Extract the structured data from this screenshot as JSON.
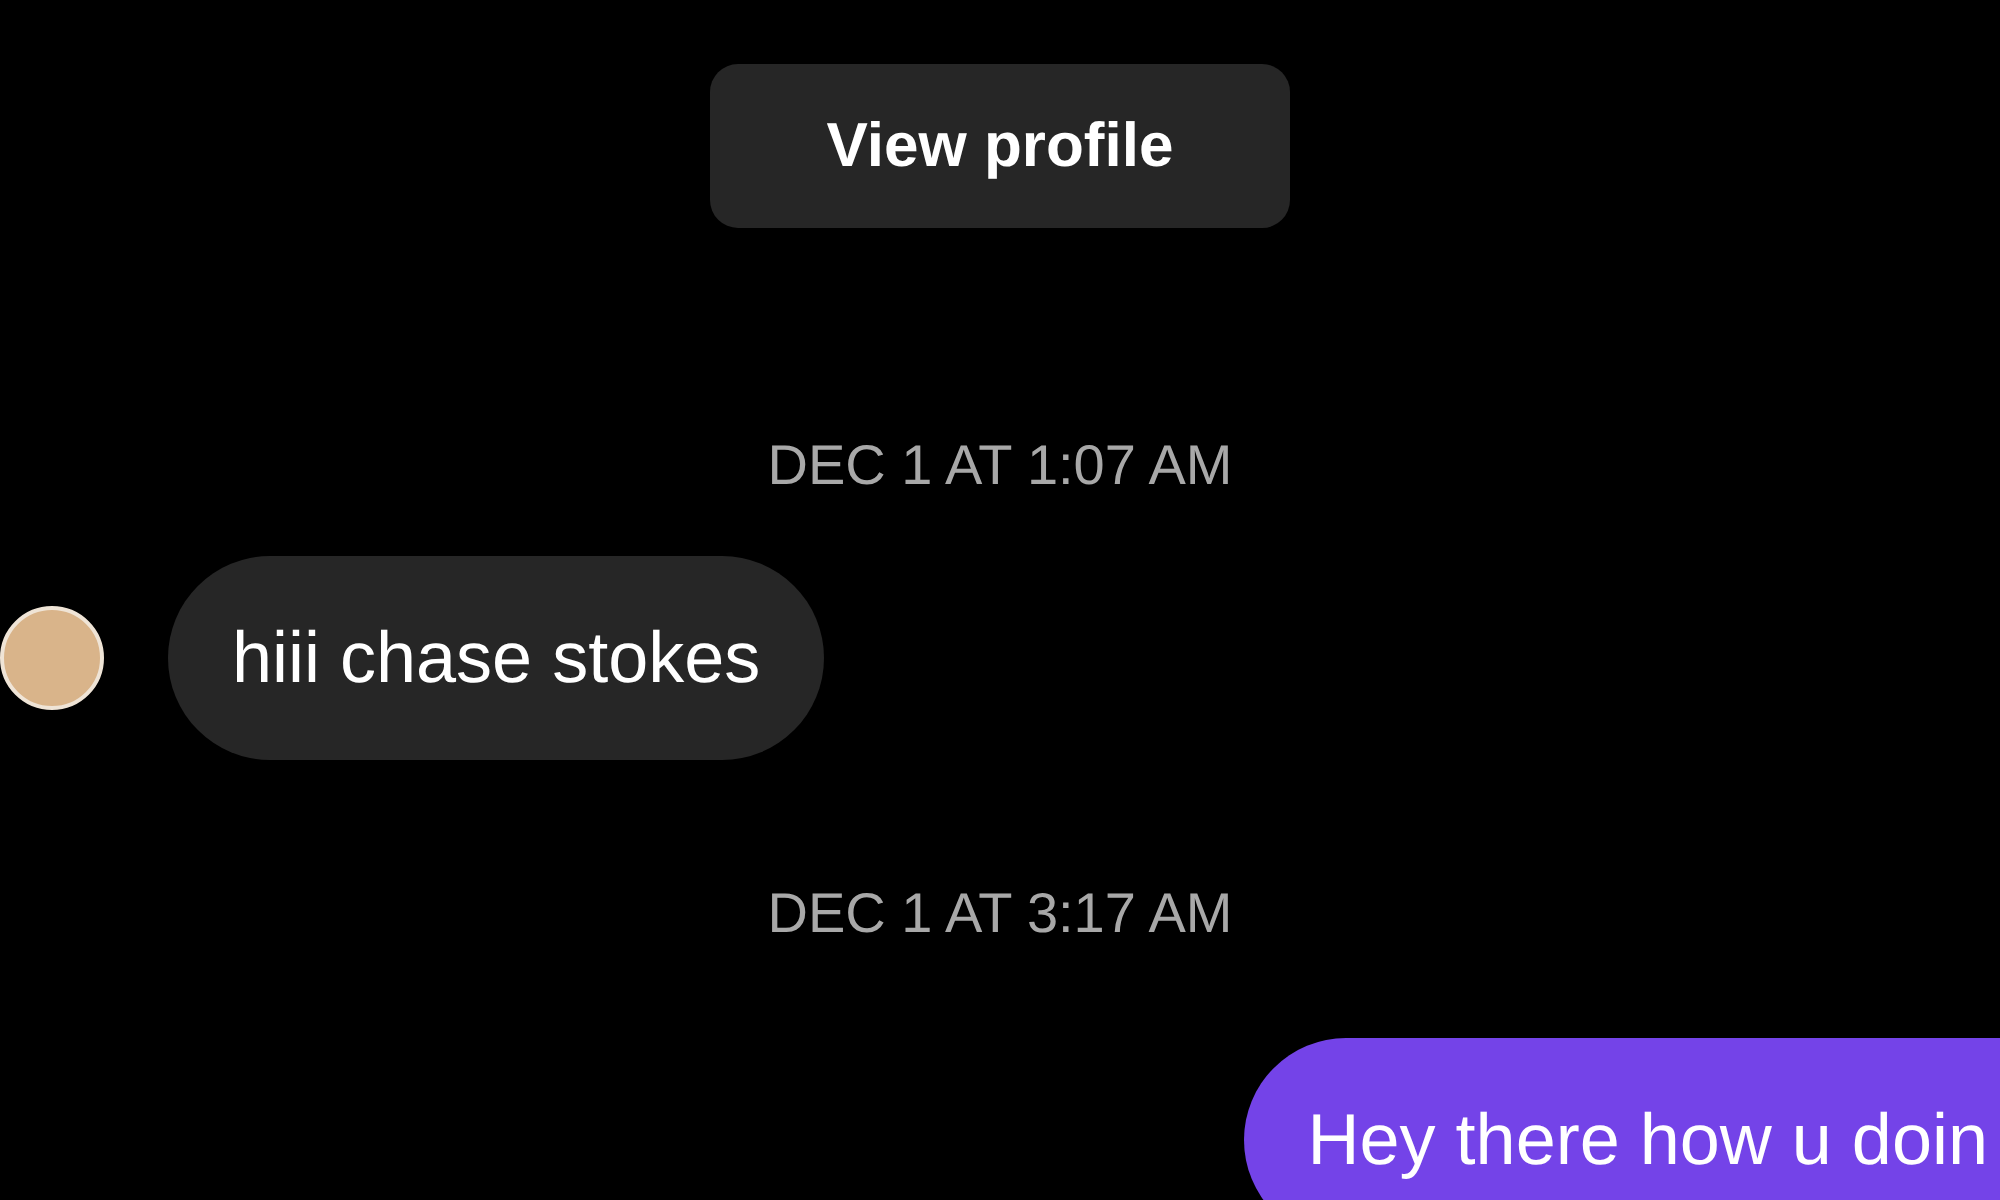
{
  "profile_button": {
    "label": "View profile"
  },
  "messages": [
    {
      "kind": "timestamp",
      "text": "DEC 1 AT 1:07 AM"
    },
    {
      "kind": "received",
      "text": "hiii chase stokes"
    },
    {
      "kind": "timestamp",
      "text": "DEC 1 AT 3:17 AM"
    },
    {
      "kind": "sent",
      "text": "Hey there how u doin"
    }
  ]
}
